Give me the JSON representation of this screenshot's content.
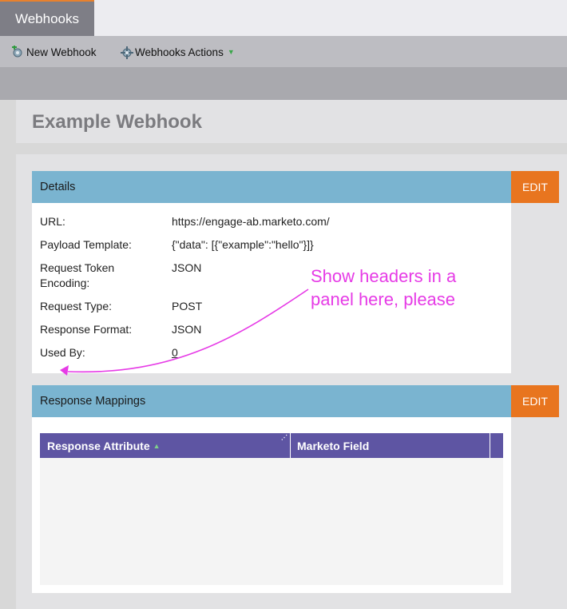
{
  "tabs": [
    {
      "label": "Webhooks",
      "active": true
    }
  ],
  "toolbar": {
    "new_webhook_label": "New Webhook",
    "actions_label": "Webhooks Actions",
    "actions_caret": "▼"
  },
  "page": {
    "title": "Example Webhook"
  },
  "details": {
    "title": "Details",
    "edit_label": "EDIT",
    "fields": [
      {
        "label": "URL:",
        "value": "https://engage-ab.marketo.com/"
      },
      {
        "label": "Payload Template:",
        "value": "{\"data\": [{\"example\":\"hello\"}]}"
      },
      {
        "label": "Request Token Encoding:",
        "value": "JSON"
      },
      {
        "label": "Request Type:",
        "value": "POST"
      },
      {
        "label": "Response Format:",
        "value": "JSON"
      },
      {
        "label": "Used By:",
        "value": "0"
      }
    ]
  },
  "mappings": {
    "title": "Response Mappings",
    "edit_label": "EDIT",
    "columns": [
      "Response Attribute",
      "Marketo Field"
    ]
  },
  "annotation": {
    "text_line1": "Show headers in a",
    "text_line2": "panel here, please"
  },
  "colors": {
    "accent_orange": "#e8751f",
    "panel_blue": "#7ab4d0",
    "grid_purple": "#5e55a3",
    "annotation_magenta": "#e63be6"
  }
}
